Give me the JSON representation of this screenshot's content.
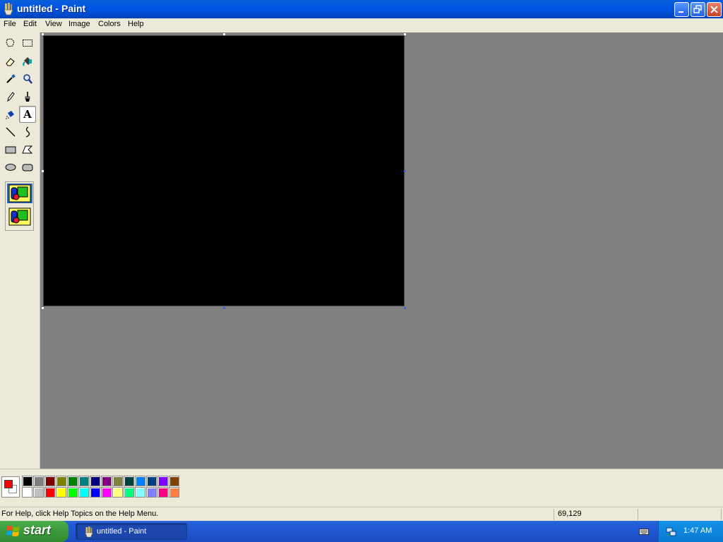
{
  "window": {
    "title": "untitled - Paint"
  },
  "menu": {
    "file": "File",
    "edit": "Edit",
    "view": "View",
    "image": "Image",
    "colors": "Colors",
    "help": "Help"
  },
  "tools": [
    {
      "name": "free-form-select-icon"
    },
    {
      "name": "select-icon"
    },
    {
      "name": "eraser-icon"
    },
    {
      "name": "fill-with-color-icon"
    },
    {
      "name": "pick-color-icon"
    },
    {
      "name": "magnifier-icon"
    },
    {
      "name": "pencil-icon"
    },
    {
      "name": "brush-icon"
    },
    {
      "name": "airbrush-icon"
    },
    {
      "name": "text-icon",
      "active": true,
      "glyph": "A"
    },
    {
      "name": "line-icon"
    },
    {
      "name": "curve-icon"
    },
    {
      "name": "rectangle-icon"
    },
    {
      "name": "polygon-icon"
    },
    {
      "name": "ellipse-icon"
    },
    {
      "name": "rounded-rectangle-icon"
    }
  ],
  "current_colors": {
    "foreground": "#ff0000",
    "background": "#ffffff"
  },
  "palette": {
    "top": [
      "#000000",
      "#808080",
      "#800000",
      "#808000",
      "#008000",
      "#008080",
      "#000080",
      "#800080",
      "#808040",
      "#004040",
      "#0080ff",
      "#004080",
      "#8000ff",
      "#804000"
    ],
    "bottom": [
      "#ffffff",
      "#c0c0c0",
      "#ff0000",
      "#ffff00",
      "#00ff00",
      "#00ffff",
      "#0000ff",
      "#ff00ff",
      "#ffff80",
      "#00ff80",
      "#80ffff",
      "#8080ff",
      "#ff0080",
      "#ff8040"
    ]
  },
  "status": {
    "help_text": "For Help, click Help Topics on the Help Menu.",
    "coords": "69,129"
  },
  "taskbar": {
    "start": "start",
    "task": "untitled - Paint",
    "clock": "1:47 AM"
  }
}
